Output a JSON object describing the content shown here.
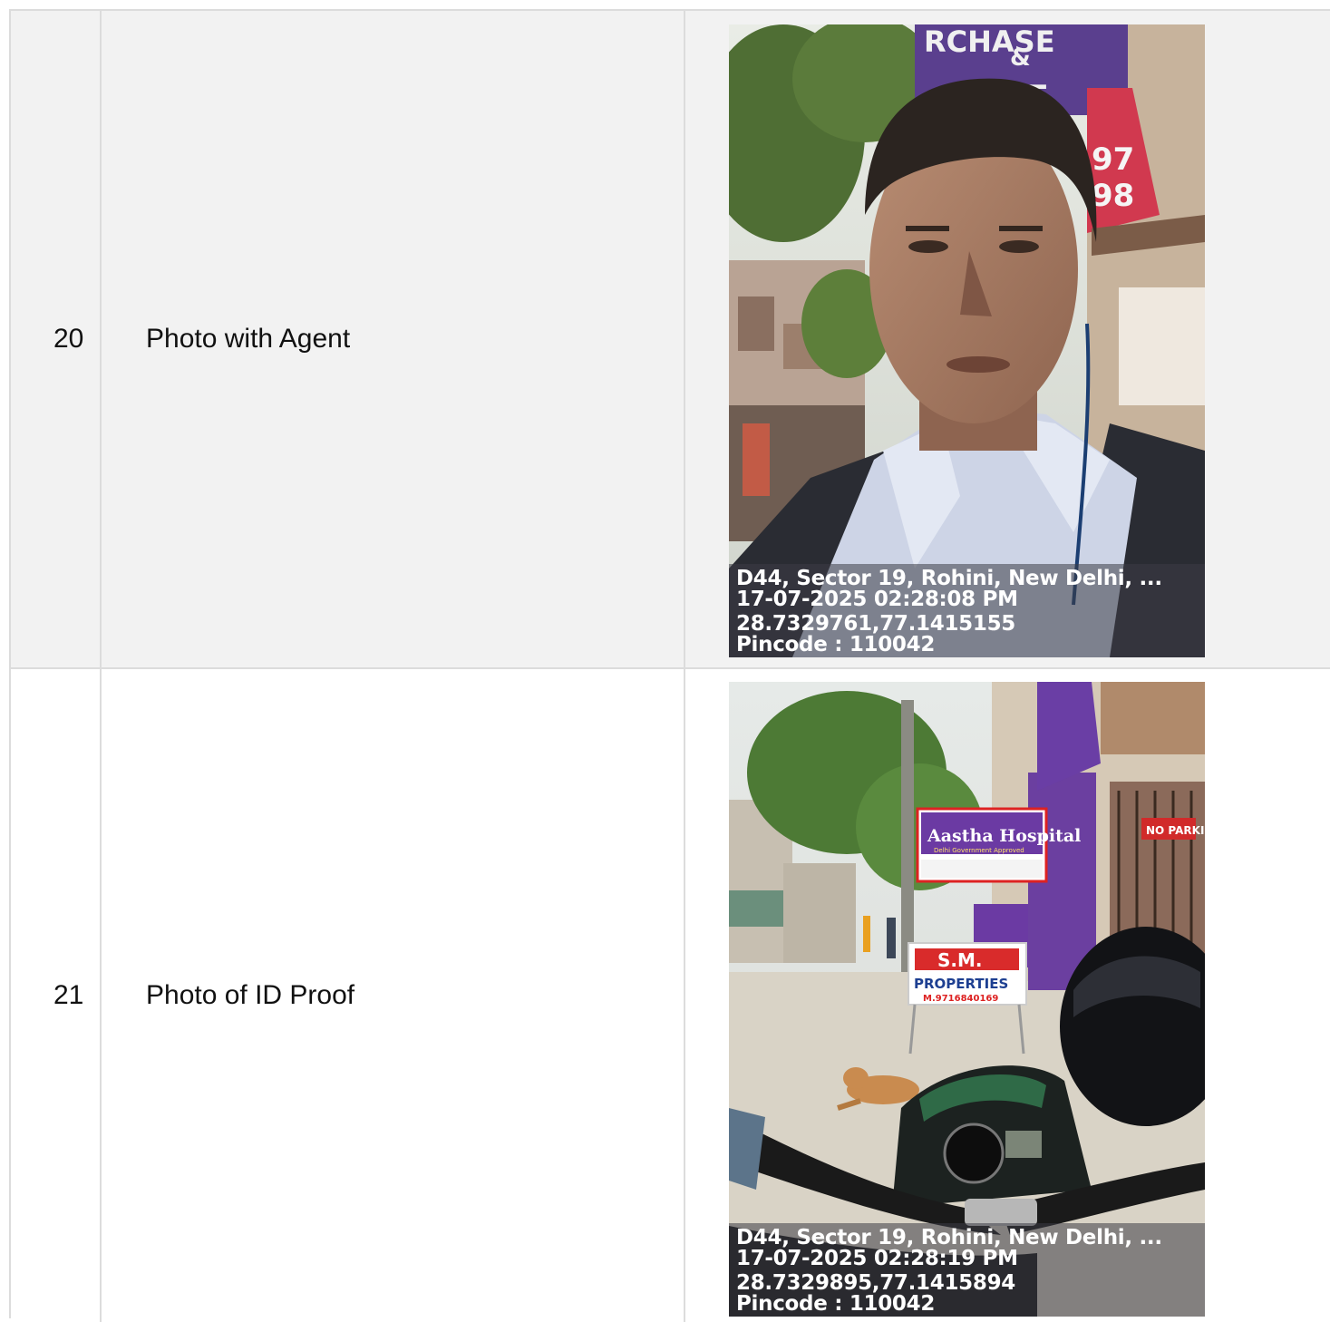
{
  "rows": [
    {
      "number": "20",
      "label": "Photo with Agent",
      "photo": {
        "subject": "selfie of man in light blue shirt on a street",
        "address": "D44, Sector 19, Rohini, New Delhi, ...",
        "timestamp": "17-07-2025 02:28:08 PM",
        "coordinates": "28.7329761,77.1415155",
        "pincode": "Pincode : 110042",
        "sign_text": [
          "RCHASE",
          "&",
          "RENT",
          "97",
          "98"
        ]
      }
    },
    {
      "number": "21",
      "label": "Photo of ID Proof",
      "photo": {
        "subject": "street with hospital signboards, motorcycle handlebar and dog in foreground",
        "address": "D44, Sector 19, Rohini, New Delhi, ...",
        "timestamp": "17-07-2025 02:28:19 PM",
        "coordinates": "28.7329895,77.1415894",
        "pincode": "Pincode : 110042",
        "sign_hospital": "Aastha Hospital",
        "sign_hospital_sub": "Delhi Government Approved",
        "sign_properties_top": "S.M.",
        "sign_properties": "PROPERTIES",
        "sign_properties_phone": "M.9716840169",
        "sign_parking": "NO PARKING"
      }
    }
  ]
}
